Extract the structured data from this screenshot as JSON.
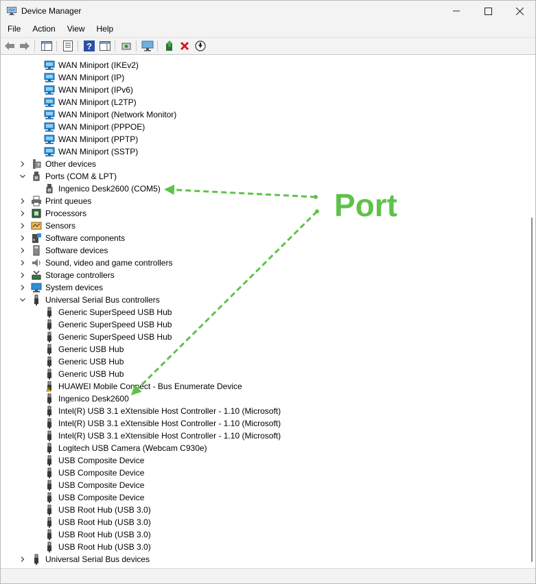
{
  "window": {
    "title": "Device Manager"
  },
  "menu": [
    "File",
    "Action",
    "View",
    "Help"
  ],
  "tree": [
    {
      "label": "WAN Miniport (IKEv2)",
      "level": 2,
      "icon": "network-adapter-icon",
      "expander": "none"
    },
    {
      "label": "WAN Miniport (IP)",
      "level": 2,
      "icon": "network-adapter-icon",
      "expander": "none"
    },
    {
      "label": "WAN Miniport (IPv6)",
      "level": 2,
      "icon": "network-adapter-icon",
      "expander": "none"
    },
    {
      "label": "WAN Miniport (L2TP)",
      "level": 2,
      "icon": "network-adapter-icon",
      "expander": "none"
    },
    {
      "label": "WAN Miniport (Network Monitor)",
      "level": 2,
      "icon": "network-adapter-icon",
      "expander": "none"
    },
    {
      "label": "WAN Miniport (PPPOE)",
      "level": 2,
      "icon": "network-adapter-icon",
      "expander": "none"
    },
    {
      "label": "WAN Miniport (PPTP)",
      "level": 2,
      "icon": "network-adapter-icon",
      "expander": "none"
    },
    {
      "label": "WAN Miniport (SSTP)",
      "level": 2,
      "icon": "network-adapter-icon",
      "expander": "none"
    },
    {
      "label": "Other devices",
      "level": 1,
      "icon": "other-devices-icon",
      "expander": "collapsed"
    },
    {
      "label": "Ports (COM & LPT)",
      "level": 1,
      "icon": "port-icon",
      "expander": "expanded"
    },
    {
      "label": "Ingenico Desk2600 (COM5)",
      "level": 2,
      "icon": "port-icon",
      "expander": "none"
    },
    {
      "label": "Print queues",
      "level": 1,
      "icon": "printer-icon",
      "expander": "collapsed"
    },
    {
      "label": "Processors",
      "level": 1,
      "icon": "processor-icon",
      "expander": "collapsed"
    },
    {
      "label": "Sensors",
      "level": 1,
      "icon": "sensor-icon",
      "expander": "collapsed"
    },
    {
      "label": "Software components",
      "level": 1,
      "icon": "software-component-icon",
      "expander": "collapsed"
    },
    {
      "label": "Software devices",
      "level": 1,
      "icon": "software-device-icon",
      "expander": "collapsed"
    },
    {
      "label": "Sound, video and game controllers",
      "level": 1,
      "icon": "speaker-icon",
      "expander": "collapsed"
    },
    {
      "label": "Storage controllers",
      "level": 1,
      "icon": "storage-controller-icon",
      "expander": "collapsed"
    },
    {
      "label": "System devices",
      "level": 1,
      "icon": "system-device-icon",
      "expander": "collapsed"
    },
    {
      "label": "Universal Serial Bus controllers",
      "level": 1,
      "icon": "usb-icon",
      "expander": "expanded"
    },
    {
      "label": "Generic SuperSpeed USB Hub",
      "level": 2,
      "icon": "usb-icon",
      "expander": "none"
    },
    {
      "label": "Generic SuperSpeed USB Hub",
      "level": 2,
      "icon": "usb-icon",
      "expander": "none"
    },
    {
      "label": "Generic SuperSpeed USB Hub",
      "level": 2,
      "icon": "usb-icon",
      "expander": "none"
    },
    {
      "label": "Generic USB Hub",
      "level": 2,
      "icon": "usb-icon",
      "expander": "none"
    },
    {
      "label": "Generic USB Hub",
      "level": 2,
      "icon": "usb-icon",
      "expander": "none"
    },
    {
      "label": "Generic USB Hub",
      "level": 2,
      "icon": "usb-icon",
      "expander": "none"
    },
    {
      "label": "HUAWEI Mobile Connect - Bus Enumerate Device",
      "level": 2,
      "icon": "warning-icon",
      "expander": "none"
    },
    {
      "label": "Ingenico Desk2600",
      "level": 2,
      "icon": "usb-icon",
      "expander": "none"
    },
    {
      "label": "Intel(R) USB 3.1 eXtensible Host Controller - 1.10 (Microsoft)",
      "level": 2,
      "icon": "usb-icon",
      "expander": "none"
    },
    {
      "label": "Intel(R) USB 3.1 eXtensible Host Controller - 1.10 (Microsoft)",
      "level": 2,
      "icon": "usb-icon",
      "expander": "none"
    },
    {
      "label": "Intel(R) USB 3.1 eXtensible Host Controller - 1.10 (Microsoft)",
      "level": 2,
      "icon": "usb-icon",
      "expander": "none"
    },
    {
      "label": "Logitech USB Camera (Webcam C930e)",
      "level": 2,
      "icon": "usb-icon",
      "expander": "none"
    },
    {
      "label": "USB Composite Device",
      "level": 2,
      "icon": "usb-icon",
      "expander": "none"
    },
    {
      "label": "USB Composite Device",
      "level": 2,
      "icon": "usb-icon",
      "expander": "none"
    },
    {
      "label": "USB Composite Device",
      "level": 2,
      "icon": "usb-icon",
      "expander": "none"
    },
    {
      "label": "USB Composite Device",
      "level": 2,
      "icon": "usb-icon",
      "expander": "none"
    },
    {
      "label": "USB Root Hub (USB 3.0)",
      "level": 2,
      "icon": "usb-icon",
      "expander": "none"
    },
    {
      "label": "USB Root Hub (USB 3.0)",
      "level": 2,
      "icon": "usb-icon",
      "expander": "none"
    },
    {
      "label": "USB Root Hub (USB 3.0)",
      "level": 2,
      "icon": "usb-icon",
      "expander": "none"
    },
    {
      "label": "USB Root Hub (USB 3.0)",
      "level": 2,
      "icon": "usb-icon",
      "expander": "none"
    },
    {
      "label": "Universal Serial Bus devices",
      "level": 1,
      "icon": "usb-icon",
      "expander": "collapsed"
    }
  ],
  "annotation": {
    "text": "Port",
    "color": "#5ec24a"
  }
}
